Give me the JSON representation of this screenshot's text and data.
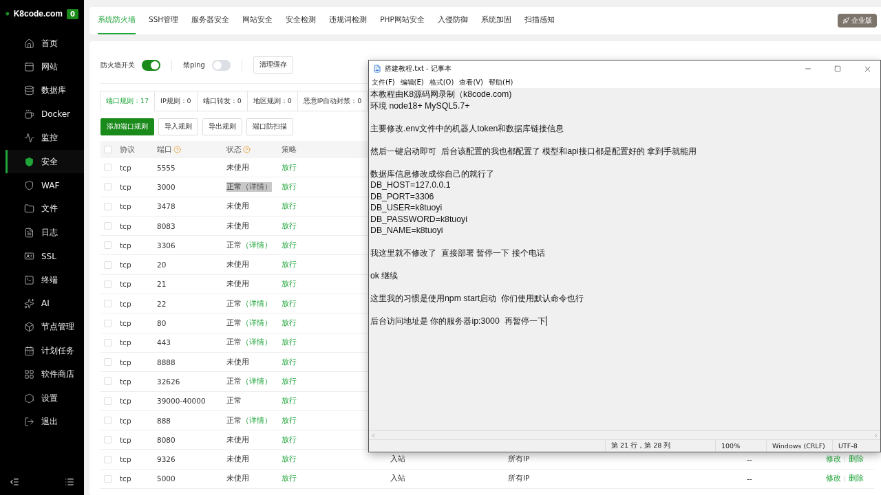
{
  "sidebar": {
    "brand": "K8code.com",
    "badge": "0",
    "items": [
      {
        "kind": "home",
        "label": "首页",
        "selected": false
      },
      {
        "kind": "site",
        "label": "网站",
        "selected": false
      },
      {
        "kind": "database",
        "label": "数据库",
        "selected": false
      },
      {
        "kind": "docker",
        "label": "Docker",
        "selected": false
      },
      {
        "kind": "monitor",
        "label": "监控",
        "selected": false
      },
      {
        "kind": "security",
        "label": "安全",
        "selected": true
      },
      {
        "kind": "waf",
        "label": "WAF",
        "selected": false
      },
      {
        "kind": "files",
        "label": "文件",
        "selected": false
      },
      {
        "kind": "logs",
        "label": "日志",
        "selected": false
      },
      {
        "kind": "ssl",
        "label": "SSL",
        "selected": false
      },
      {
        "kind": "terminal",
        "label": "终端",
        "selected": false
      },
      {
        "kind": "ai",
        "label": "AI",
        "selected": false
      },
      {
        "kind": "nodes",
        "label": "节点管理",
        "selected": false
      },
      {
        "kind": "cron",
        "label": "计划任务",
        "selected": false
      },
      {
        "kind": "store",
        "label": "软件商店",
        "selected": false
      },
      {
        "kind": "settings",
        "label": "设置",
        "selected": false
      },
      {
        "kind": "logout",
        "label": "退出",
        "selected": false
      }
    ]
  },
  "top_tabs": [
    {
      "label": "系统防火墙",
      "selected": true
    },
    {
      "label": "SSH管理",
      "selected": false
    },
    {
      "label": "服务器安全",
      "selected": false
    },
    {
      "label": "网站安全",
      "selected": false
    },
    {
      "label": "安全检测",
      "selected": false
    },
    {
      "label": "违规词检测",
      "selected": false
    },
    {
      "label": "PHP网站安全",
      "selected": false
    },
    {
      "label": "入侵防御",
      "selected": false
    },
    {
      "label": "系统加固",
      "selected": false
    },
    {
      "label": "扫描感知",
      "selected": false
    }
  ],
  "edition_button": "企业版",
  "switches": [
    {
      "label": "防火墙开关",
      "on": true
    },
    {
      "label": "禁ping",
      "on": false
    }
  ],
  "clear_cache_button": "清理缓存",
  "rule_tabs": [
    {
      "label": "端口规则：17",
      "selected": true
    },
    {
      "label": "IP规则：0",
      "selected": false
    },
    {
      "label": "端口转发：0",
      "selected": false
    },
    {
      "label": "地区规则：0",
      "selected": false
    },
    {
      "label": "恶意IP自动封禁：0",
      "selected": false
    }
  ],
  "actions": [
    {
      "label": "添加端口规则",
      "kind": "primary"
    },
    {
      "label": "导入规则",
      "kind": "plain"
    },
    {
      "label": "导出规则",
      "kind": "plain"
    },
    {
      "label": "端口防扫描",
      "kind": "plain"
    }
  ],
  "table": {
    "all_checked": false,
    "columns": [
      {
        "label": "协议",
        "help": false
      },
      {
        "label": "端口",
        "help": true
      },
      {
        "label": "状态",
        "help": true
      },
      {
        "label": "策略",
        "help": false
      }
    ],
    "rows": [
      {
        "protocol": "tcp",
        "port": "5555",
        "status": "未使用",
        "policy": "放行",
        "highlighted": false,
        "checked": false
      },
      {
        "protocol": "tcp",
        "port": "3000",
        "status": "正常",
        "detail": "（详情）",
        "policy": "放行",
        "highlighted": true,
        "checked": false
      },
      {
        "protocol": "tcp",
        "port": "3478",
        "status": "未使用",
        "policy": "放行",
        "highlighted": false,
        "checked": false
      },
      {
        "protocol": "tcp",
        "port": "8083",
        "status": "未使用",
        "policy": "放行",
        "highlighted": false,
        "checked": false
      },
      {
        "protocol": "tcp",
        "port": "3306",
        "status": "正常",
        "detail": "（详情）",
        "policy": "放行",
        "highlighted": false,
        "checked": false
      },
      {
        "protocol": "tcp",
        "port": "20",
        "status": "未使用",
        "policy": "放行",
        "highlighted": false,
        "checked": false
      },
      {
        "protocol": "tcp",
        "port": "21",
        "status": "未使用",
        "policy": "放行",
        "highlighted": false,
        "checked": false
      },
      {
        "protocol": "tcp",
        "port": "22",
        "status": "正常",
        "detail": "（详情）",
        "policy": "放行",
        "highlighted": false,
        "checked": false
      },
      {
        "protocol": "tcp",
        "port": "80",
        "status": "正常",
        "detail": "（详情）",
        "policy": "放行",
        "highlighted": false,
        "checked": false
      },
      {
        "protocol": "tcp",
        "port": "443",
        "status": "正常",
        "detail": "（详情）",
        "policy": "放行",
        "highlighted": false,
        "checked": false
      },
      {
        "protocol": "tcp",
        "port": "8888",
        "status": "未使用",
        "policy": "放行",
        "highlighted": false,
        "checked": false
      },
      {
        "protocol": "tcp",
        "port": "32626",
        "status": "正常",
        "detail": "（详情）",
        "policy": "放行",
        "highlighted": false,
        "checked": false
      },
      {
        "protocol": "tcp",
        "port": "39000-40000",
        "status": "正常",
        "policy": "放行",
        "highlighted": false,
        "checked": false
      },
      {
        "protocol": "tcp",
        "port": "888",
        "status": "正常",
        "detail": "（详情）",
        "policy": "放行",
        "highlighted": false,
        "checked": false
      },
      {
        "protocol": "tcp",
        "port": "8080",
        "status": "未使用",
        "policy": "放行",
        "highlighted": false,
        "checked": false
      },
      {
        "protocol": "tcp",
        "port": "9326",
        "status": "未使用",
        "policy": "放行",
        "direction": "入站",
        "source": "所有IP",
        "remark": "--",
        "edit": "修改",
        "delete": "删除",
        "highlighted": false,
        "checked": false
      },
      {
        "protocol": "tcp",
        "port": "5000",
        "status": "未使用",
        "policy": "放行",
        "direction": "入站",
        "source": "所有IP",
        "remark": "--",
        "edit": "修改",
        "delete": "删除",
        "highlighted": false,
        "checked": false
      }
    ]
  },
  "notepad": {
    "title": "搭建教程.txt - 记事本",
    "menu": [
      "文件(F)",
      "编辑(E)",
      "格式(O)",
      "查看(V)",
      "帮助(H)"
    ],
    "paragraphs": [
      [
        "本教程由K8源码网录制（k8code.com)",
        "环境 node18+ MySQL5.7+"
      ],
      [
        "主要修改.env文件中的机器人token和数据库链接信息"
      ],
      [
        "然后一键启动即可  后台该配置的我也都配置了 模型和api接口都是配置好的 拿到手就能用"
      ],
      [
        "数据库信息修改成你自己的就行了",
        "DB_HOST=127.0.0.1",
        "DB_PORT=3306",
        "DB_USER=k8tuoyi",
        "DB_PASSWORD=k8tuoyi",
        "DB_NAME=k8tuoyi"
      ],
      [
        "我这里就不修改了  直接部署 暂停一下 接个电话"
      ],
      [
        "ok 继续"
      ],
      [
        "这里我的习惯是使用npm start启动  你们使用默认命令也行"
      ],
      [
        "后台访问地址是 你的服务器ip:3000  再暂停一下"
      ]
    ],
    "status": [
      "第 21 行，第 28 列",
      "100%",
      "Windows (CRLF)",
      "UTF-8"
    ]
  }
}
